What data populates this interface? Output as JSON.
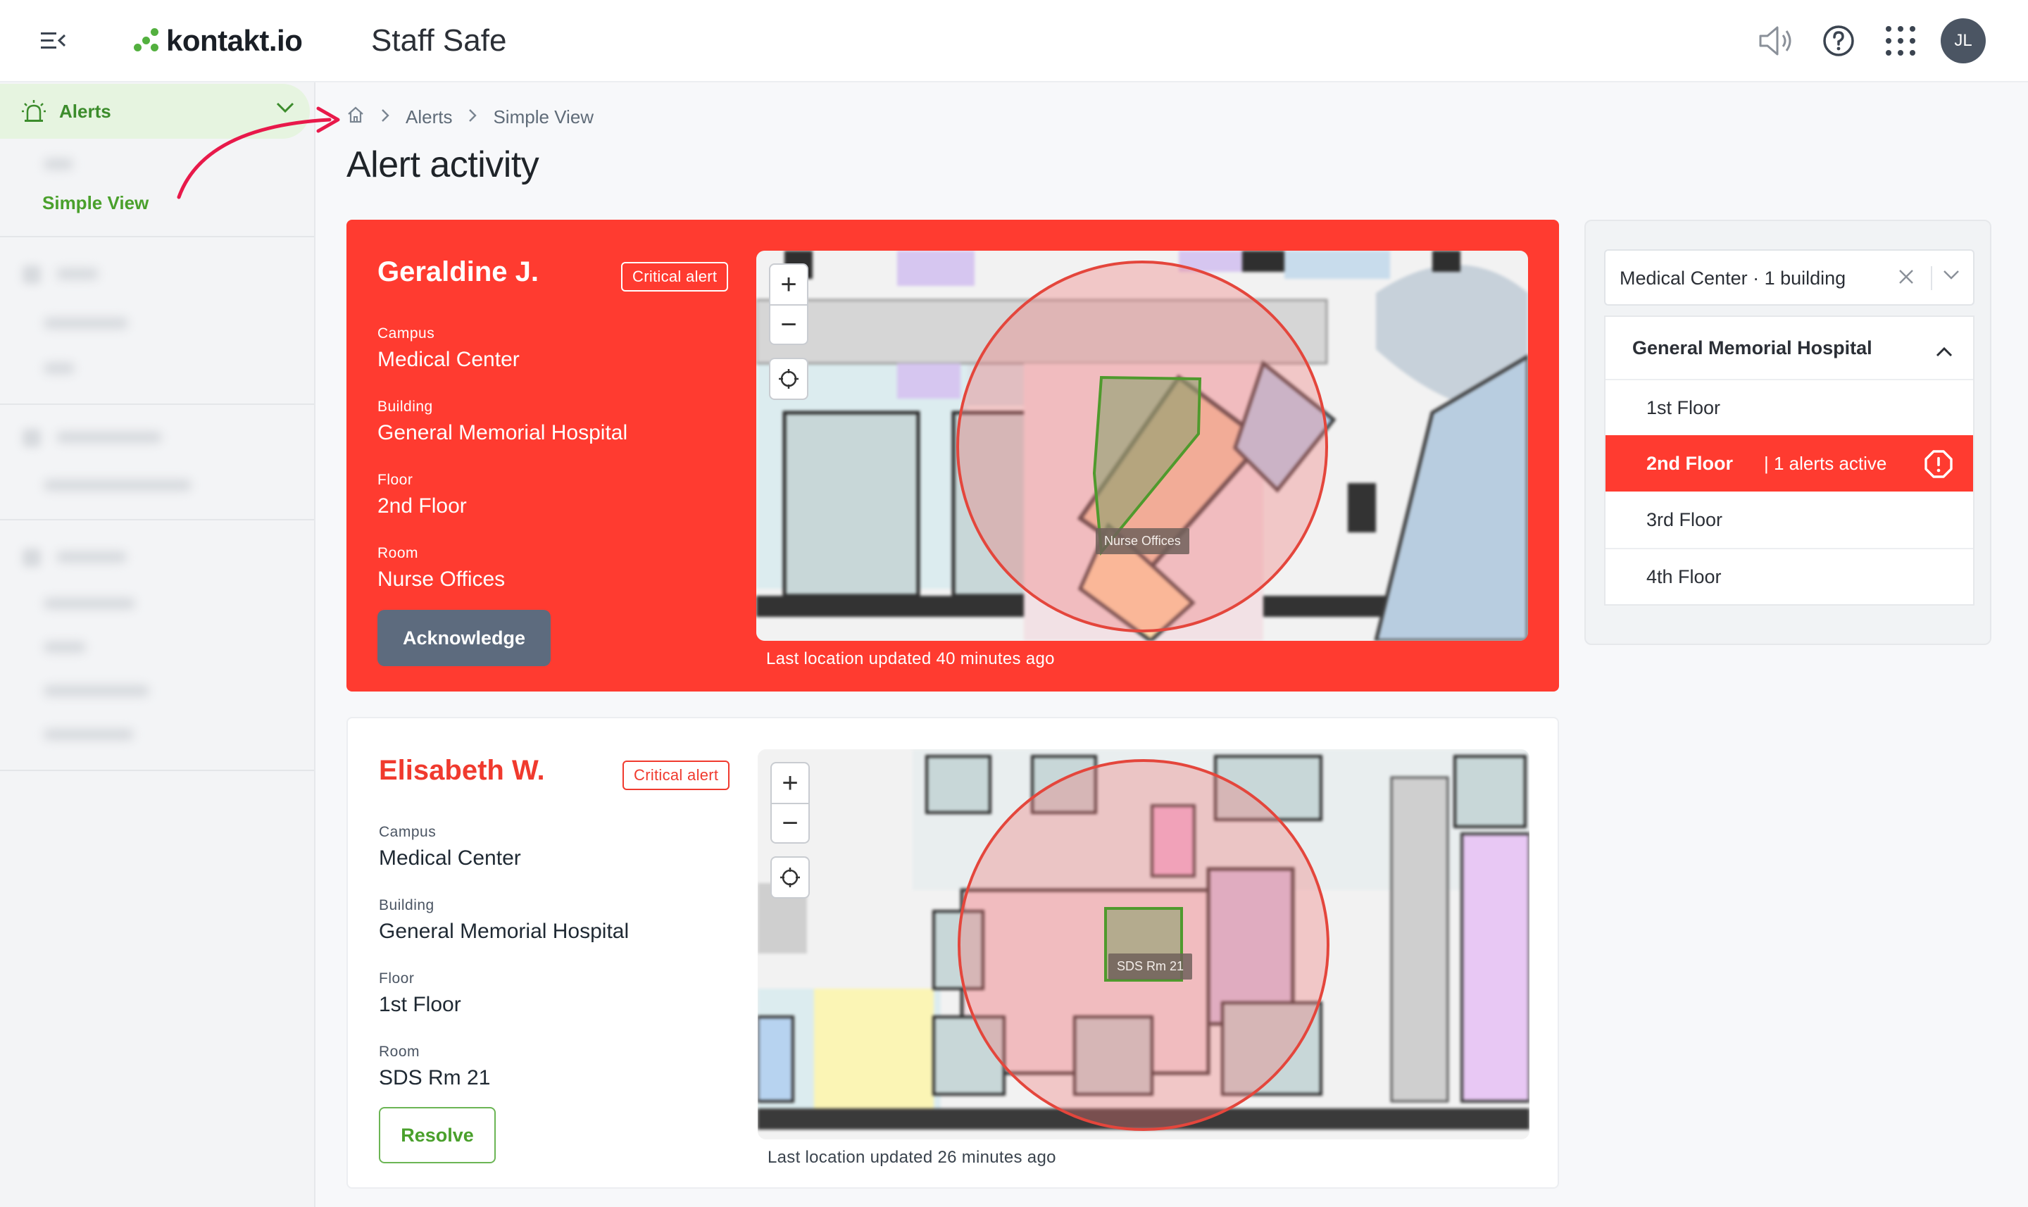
{
  "header": {
    "logo_text": "kontakt.io",
    "app_title": "Staff Safe",
    "user_initials": "JL",
    "icons": [
      "menu-collapse-icon",
      "speaker-icon",
      "help-icon",
      "apps-grid-icon"
    ]
  },
  "sidebar": {
    "alerts_label": "Alerts",
    "simple_view_label": "Simple View"
  },
  "breadcrumb": {
    "items": [
      "Alerts",
      "Simple View"
    ]
  },
  "page": {
    "title": "Alert activity"
  },
  "alerts": [
    {
      "name": "Geraldine J.",
      "badge": "Critical alert",
      "campus_label": "Campus",
      "campus": "Medical Center",
      "building_label": "Building",
      "building": "General Memorial Hospital",
      "floor_label": "Floor",
      "floor": "2nd Floor",
      "room_label": "Room",
      "room": "Nurse Offices",
      "action": "Acknowledge",
      "map_label": "Nurse Offices",
      "last_update": "Last location updated 40 minutes ago"
    },
    {
      "name": "Elisabeth W.",
      "badge": "Critical alert",
      "campus_label": "Campus",
      "campus": "Medical Center",
      "building_label": "Building",
      "building": "General Memorial Hospital",
      "floor_label": "Floor",
      "floor": "1st Floor",
      "room_label": "Room",
      "room": "SDS Rm 21",
      "action": "Resolve",
      "map_label": "SDS Rm 21",
      "last_update": "Last location updated 26 minutes ago"
    }
  ],
  "location_panel": {
    "selector_value": "Medical Center · 1 building",
    "building": "General Memorial Hospital",
    "floors": [
      {
        "name": "1st Floor",
        "alert": ""
      },
      {
        "name": "2nd Floor",
        "alert": "| 1 alerts active"
      },
      {
        "name": "3rd Floor",
        "alert": ""
      },
      {
        "name": "4th Floor",
        "alert": ""
      }
    ]
  },
  "colors": {
    "brand_green": "#53b03f",
    "critical_red": "#ff3b30",
    "acknowledge_button": "#5d6b7e"
  }
}
